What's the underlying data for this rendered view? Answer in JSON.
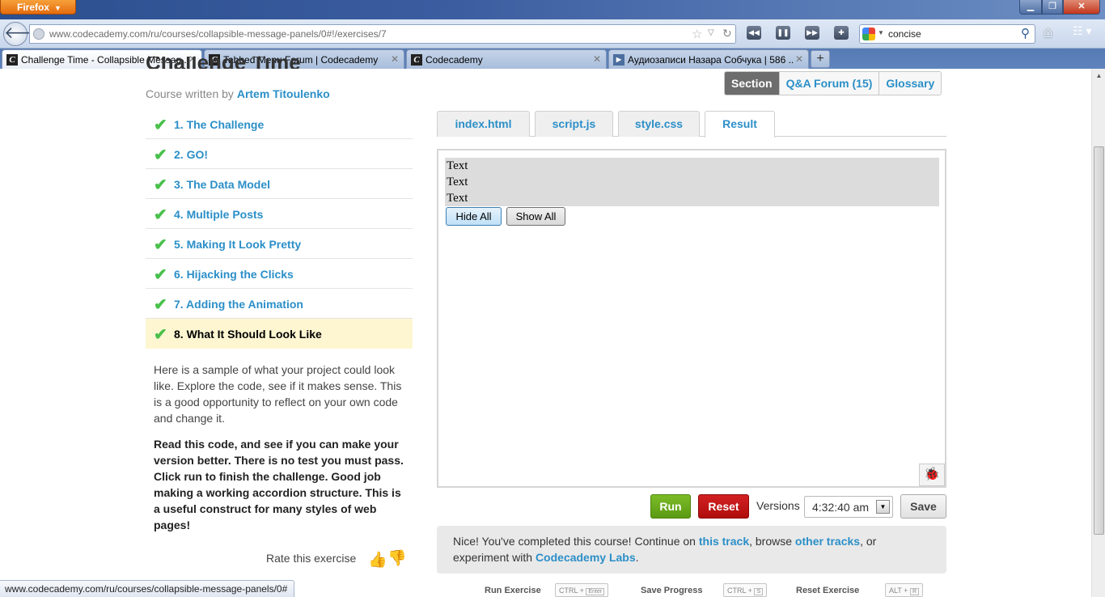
{
  "browser": {
    "app_button": "Firefox",
    "url": "www.codecademy.com/ru/courses/collapsible-message-panels/0#!/exercises/7",
    "search_query": "concise",
    "tabs": [
      {
        "title": "Challenge Time - Collapsible Messag...",
        "favicon": "C"
      },
      {
        "title": "Tabbed Menu Forum | Codecademy",
        "favicon": "C"
      },
      {
        "title": "Codecademy",
        "favicon": "C"
      },
      {
        "title": "Аудиозаписи Назара Собчука | 586 ...",
        "favicon": "▶"
      }
    ],
    "status_url": "www.codecademy.com/ru/courses/collapsible-message-panels/0#"
  },
  "page": {
    "title": "Challenge Time",
    "author_prefix": "Course written by",
    "author_name": "Artem Titoulenko",
    "lessons": [
      {
        "label": "1. The Challenge"
      },
      {
        "label": "2. GO!"
      },
      {
        "label": "3. The Data Model"
      },
      {
        "label": "4. Multiple Posts"
      },
      {
        "label": "5. Making It Look Pretty"
      },
      {
        "label": "6. Hijacking the Clicks"
      },
      {
        "label": "7. Adding the Animation"
      },
      {
        "label": "8. What It Should Look Like"
      }
    ],
    "description": "Here is a sample of what your project could look like. Explore the code, see if it makes sense. This is a good opportunity to reflect on your own code and change it.",
    "instructions": "Read this code, and see if you can make your version better. There is no test you must pass. Click run to finish the challenge. Good job making a working accordion structure. This is a useful construct for many styles of web pages!",
    "rate_label": "Rate this exercise"
  },
  "nav_tabs": {
    "section": "Section",
    "forum": "Q&A Forum (15)",
    "glossary": "Glossary"
  },
  "file_tabs": [
    "index.html",
    "script.js",
    "style.css",
    "Result"
  ],
  "result": {
    "texts": [
      "Text",
      "Text",
      "Text"
    ],
    "hide_all": "Hide All",
    "show_all": "Show All"
  },
  "controls": {
    "run": "Run",
    "reset": "Reset",
    "versions_label": "Versions",
    "versions_value": "4:32:40 am",
    "save": "Save"
  },
  "completion": {
    "part1": "Nice! You've completed this course! Continue on",
    "link1": "this track",
    "part2": ", browse",
    "link2": "other tracks",
    "part3": ", or experiment with",
    "link3": "Codecademy Labs",
    "part4": "."
  },
  "shortcuts": [
    {
      "label": "Run Exercise",
      "mod": "CTRL +",
      "key": "Enter"
    },
    {
      "label": "Save Progress",
      "mod": "CTRL +",
      "key": "S"
    },
    {
      "label": "Reset Exercise",
      "mod": "ALT +",
      "key": "R"
    }
  ],
  "colors": {
    "link": "#2b8fc8",
    "check": "#49c04b",
    "run": "#6aa81d",
    "reset": "#c01414",
    "active_lesson_bg": "#fdf6d1"
  }
}
